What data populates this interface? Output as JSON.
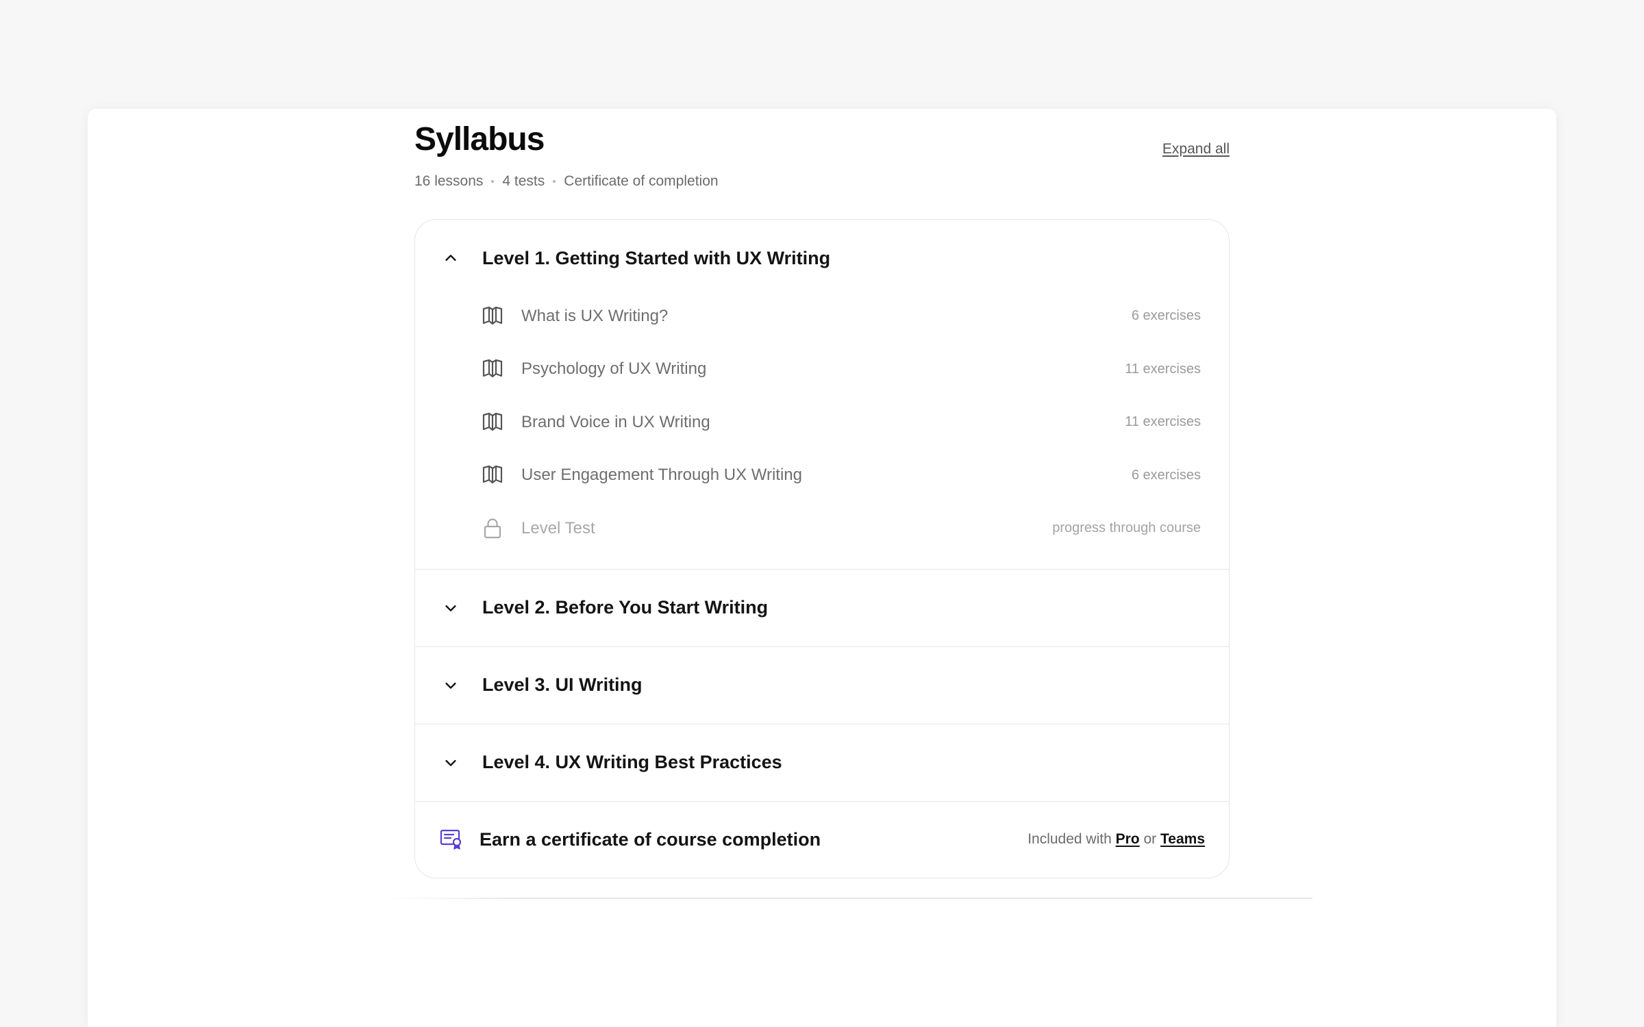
{
  "syllabus": {
    "title": "Syllabus",
    "meta": {
      "lessons": "16 lessons",
      "tests": "4 tests",
      "certificate": "Certificate of completion"
    },
    "expand_all_label": "Expand all",
    "levels": [
      {
        "title": "Level 1. Getting Started with UX Writing",
        "expanded": true,
        "lessons": [
          {
            "title": "What is UX Writing?",
            "meta": "6 exercises",
            "icon": "open-book-icon"
          },
          {
            "title": "Psychology of UX Writing",
            "meta": "11 exercises",
            "icon": "open-book-icon"
          },
          {
            "title": "Brand Voice in UX Writing",
            "meta": "11 exercises",
            "icon": "open-book-icon"
          },
          {
            "title": "User Engagement Through UX Writing",
            "meta": "6 exercises",
            "icon": "open-book-icon"
          },
          {
            "title": "Level Test",
            "meta": "progress through course",
            "icon": "lock-icon"
          }
        ]
      },
      {
        "title": "Level 2. Before You Start Writing",
        "expanded": false
      },
      {
        "title": "Level 3. UI Writing",
        "expanded": false
      },
      {
        "title": "Level 4. UX Writing Best Practices",
        "expanded": false
      }
    ],
    "certificate": {
      "title": "Earn a certificate of course completion",
      "included_prefix": "Included with",
      "pro_label": "Pro",
      "or_label": "or",
      "teams_label": "Teams",
      "icon": "certificate-icon",
      "icon_color": "#5b3fd1"
    }
  }
}
